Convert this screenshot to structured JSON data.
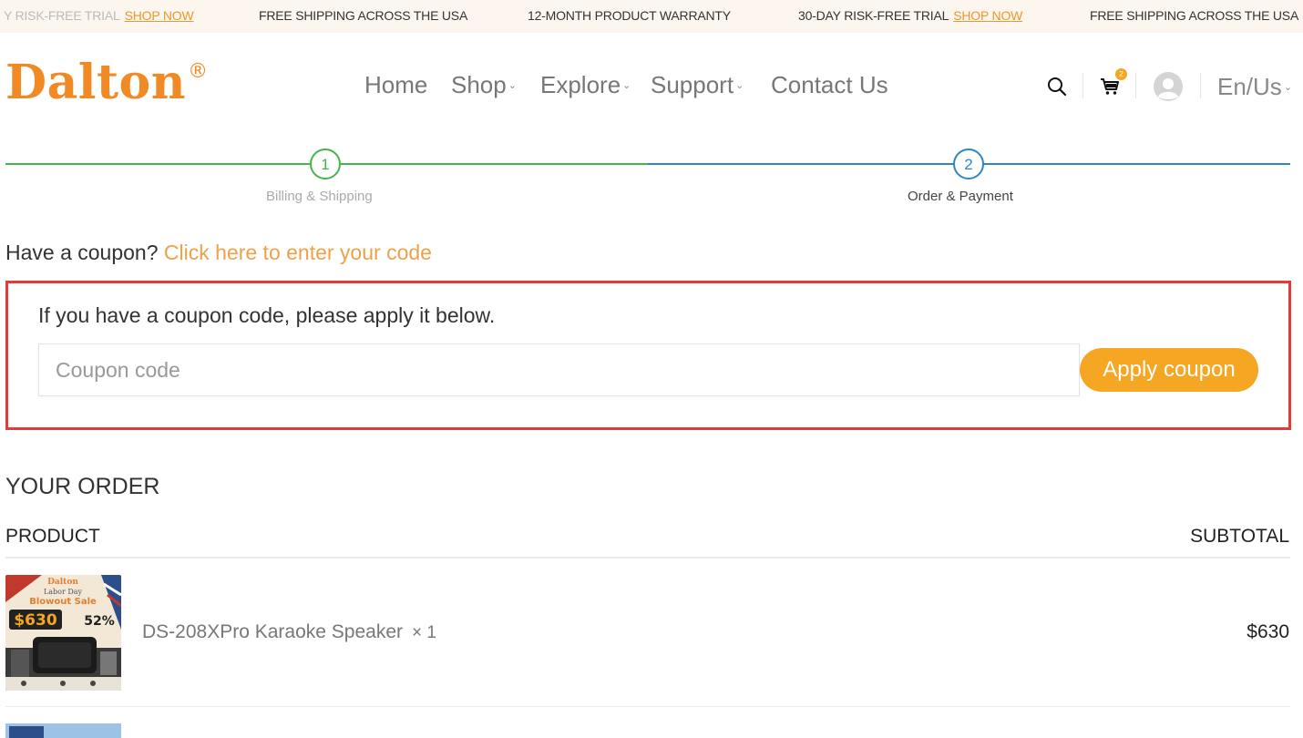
{
  "promo": {
    "items": [
      {
        "text": "Y RISK-FREE TRIAL",
        "link": "SHOP NOW"
      },
      {
        "text": "FREE SHIPPING ACROSS THE USA",
        "link": ""
      },
      {
        "text": "12-MONTH PRODUCT WARRANTY",
        "link": ""
      },
      {
        "text": "30-DAY RISK-FREE TRIAL",
        "link": "SHOP NOW"
      },
      {
        "text": "FREE SHIPPING ACROSS THE USA",
        "link": ""
      }
    ]
  },
  "header": {
    "logo": "Dalton",
    "logo_mark": "®",
    "nav": [
      {
        "label": "Home",
        "dropdown": false
      },
      {
        "label": "Shop",
        "dropdown": true
      },
      {
        "label": "Explore",
        "dropdown": true
      },
      {
        "label": "Support",
        "dropdown": true
      },
      {
        "label": "Contact Us",
        "dropdown": false
      }
    ],
    "cart_count": "2",
    "language": "En/Us",
    "icons": [
      "search-icon",
      "cart-icon",
      "user-avatar-icon",
      "chevron-down-icon"
    ]
  },
  "stepper": {
    "steps": [
      {
        "number": "1",
        "label": "Billing & Shipping",
        "color": "#43b649"
      },
      {
        "number": "2",
        "label": "Order & Payment",
        "color": "#2f86c4"
      }
    ]
  },
  "coupon": {
    "question": "Have a coupon?",
    "link": "Click here to enter your code",
    "description": "If you have a coupon code, please apply it below.",
    "placeholder": "Coupon code",
    "value": "",
    "button": "Apply coupon",
    "highlight_color": "#e03c3c",
    "accent_color": "#f5a623"
  },
  "order": {
    "title": "YOUR ORDER",
    "columns": [
      "PRODUCT",
      "SUBTOTAL"
    ],
    "items": [
      {
        "name": "DS-208XPro Karaoke Speaker",
        "qty": "× 1",
        "subtotal": "$630",
        "thumb": {
          "brand": "Dalton",
          "line1": "Labor Day",
          "line2": "Blowout Sale",
          "price": "$630",
          "discount": "52%"
        }
      }
    ]
  }
}
